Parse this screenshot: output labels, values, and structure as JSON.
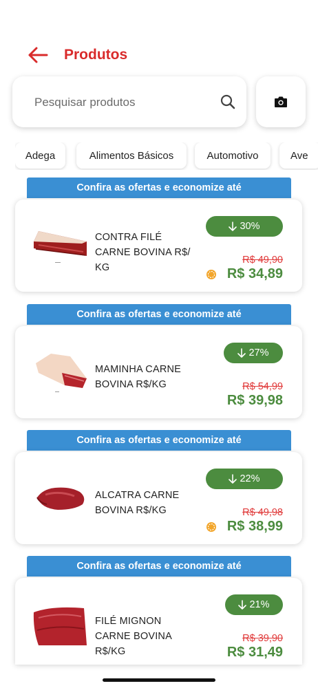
{
  "header": {
    "title": "Produtos"
  },
  "search": {
    "placeholder": "Pesquisar produtos"
  },
  "categories": [
    "Adega",
    "Alimentos Básicos",
    "Automotivo",
    "Ave"
  ],
  "banner_text": "Confira as ofertas e economize até",
  "products": [
    {
      "name": "CONTRA FILÉ CARNE BOVINA R$/ KG",
      "discount": "30%",
      "old_price": "R$ 49,90",
      "new_price": "R$ 34,89",
      "has_coin": true
    },
    {
      "name": "MAMINHA CARNE BOVINA R$/KG",
      "discount": "27%",
      "old_price": "R$ 54,99",
      "new_price": "R$ 39,98",
      "has_coin": false
    },
    {
      "name": "ALCATRA CARNE BOVINA R$/KG",
      "discount": "22%",
      "old_price": "R$ 49,98",
      "new_price": "R$ 38,99",
      "has_coin": true
    },
    {
      "name": "FILÉ MIGNON CARNE BOVINA R$/KG",
      "discount": "21%",
      "old_price": "R$ 39,90",
      "new_price": "R$ 31,49",
      "has_coin": false
    }
  ],
  "colors": {
    "accent_red": "#d92b2b",
    "banner_blue": "#3a8fd3",
    "discount_green": "#4c8c3f",
    "price_red": "#e03a3a"
  },
  "icons": {
    "back": "arrow-left-icon",
    "search": "search-icon",
    "camera": "camera-icon",
    "discount": "arrow-down-icon",
    "coin": "coin-icon"
  }
}
